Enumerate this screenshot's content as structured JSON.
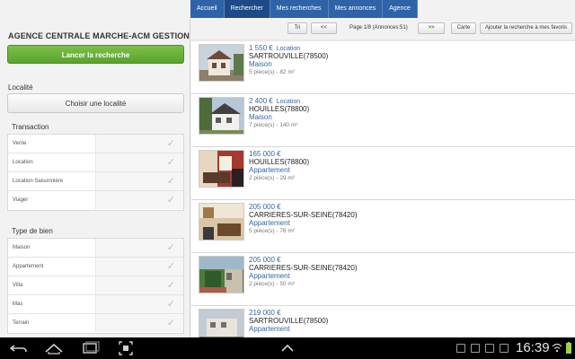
{
  "nav": {
    "tabs": [
      {
        "label": "Accueil",
        "active": false
      },
      {
        "label": "Rechercher",
        "active": true
      },
      {
        "label": "Mes recherches",
        "active": false
      },
      {
        "label": "Mes annonces",
        "active": false
      },
      {
        "label": "Agence",
        "active": false
      }
    ]
  },
  "sidebar": {
    "agency_name": "AGENCE CENTRALE MARCHE-ACM GESTION",
    "search_button": "Lancer la recherche",
    "locality_label": "Localité",
    "locality_button": "Choisir une localité",
    "transaction": {
      "label": "Transaction",
      "options": [
        "Vente",
        "Location",
        "Location Saisonnière",
        "Viager"
      ]
    },
    "property_type": {
      "label": "Type de bien",
      "options": [
        "Maison",
        "Appartement",
        "Villa",
        "Mas",
        "Terrain"
      ]
    }
  },
  "pager": {
    "sort_label": "Tri",
    "prev_label": "<<",
    "page_info": "Page 1/8 (Annonces:51)",
    "next_label": ">>",
    "map_label": "Carte",
    "save_search_label": "Ajouter la recherche à mes favoris"
  },
  "listings": [
    {
      "price": "1 550 €",
      "tag": "Location",
      "city": "SARTROUVILLE(78500)",
      "type": "Maison",
      "details": "5 pièce(s) - 82 m²"
    },
    {
      "price": "2 400 €",
      "tag": "Location",
      "city": "HOUILLES(78800)",
      "type": "Maison",
      "details": "7 pièce(s) - 140 m²"
    },
    {
      "price": "165 000 €",
      "tag": "",
      "city": "HOUILLES(78800)",
      "type": "Appartement",
      "details": "2 pièce(s) - 29 m²"
    },
    {
      "price": "205 000 €",
      "tag": "",
      "city": "CARRIERES-SUR-SEINE(78420)",
      "type": "Appartement",
      "details": "5 pièce(s) - 78 m²"
    },
    {
      "price": "205 000 €",
      "tag": "",
      "city": "CARRIERES-SUR-SEINE(78420)",
      "type": "Appartement",
      "details": "2 pièce(s) - 50 m²"
    },
    {
      "price": "219 000 €",
      "tag": "",
      "city": "SARTROUVILLE(78500)",
      "type": "Appartement",
      "details": ""
    }
  ],
  "system_bar": {
    "time": "16:39",
    "back_icon": "back-icon",
    "home_icon": "home-icon",
    "recent_icon": "recent-apps-icon",
    "screenshot_icon": "screenshot-icon",
    "up_icon": "chevron-up-icon"
  },
  "colors": {
    "nav_blue": "#2f63a8",
    "green_button": "#5aa32e",
    "link_blue": "#3566a8"
  }
}
